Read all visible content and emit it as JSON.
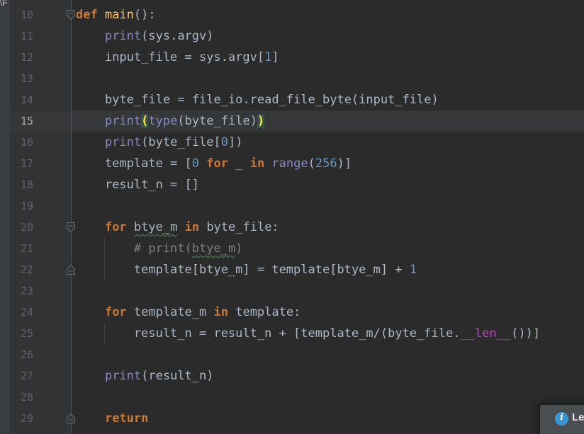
{
  "theme": {
    "bg-editor": "#2B2B2B",
    "bg-gutter": "#313335",
    "bg-active-line": "#353739",
    "keyword-color": "#CC7832",
    "builtin-color": "#8888C6",
    "function-color": "#FFC66D",
    "number-color": "#6897BB",
    "comment-color": "#808080",
    "dunder-color": "#B44EB4",
    "matched-paren-color": "#FFEF28",
    "matched-paren-bg": "#3B514D",
    "typo-squiggle-color": "#4F8F51",
    "notification-accent": "#3896D3"
  },
  "side_strip": {
    "label": "\\F"
  },
  "editor": {
    "active_line": "15",
    "lines": [
      {
        "num": "10",
        "fold": "start",
        "tokens": [
          [
            "k",
            "def"
          ],
          [
            "d",
            " "
          ],
          [
            "f",
            "main"
          ],
          [
            "d",
            "():"
          ]
        ]
      },
      {
        "num": "11",
        "tokens": [
          [
            "d",
            "    "
          ],
          [
            "b",
            "print"
          ],
          [
            "d",
            "(sys.argv)"
          ]
        ]
      },
      {
        "num": "12",
        "tokens": [
          [
            "d",
            "    input_file = sys.argv["
          ],
          [
            "n",
            "1"
          ],
          [
            "d",
            "]"
          ]
        ]
      },
      {
        "num": "13",
        "tokens": []
      },
      {
        "num": "14",
        "tokens": [
          [
            "d",
            "    byte_file = file_io.read_file_byte(input_file)"
          ]
        ]
      },
      {
        "num": "15",
        "tokens": [
          [
            "d",
            "    "
          ],
          [
            "b",
            "print"
          ],
          [
            "pm",
            "("
          ],
          [
            "b",
            "type"
          ],
          [
            "d",
            "(byte_file)"
          ],
          [
            "pm",
            ")"
          ]
        ]
      },
      {
        "num": "16",
        "tokens": [
          [
            "d",
            "    "
          ],
          [
            "b",
            "print"
          ],
          [
            "d",
            "(byte_file["
          ],
          [
            "n",
            "0"
          ],
          [
            "d",
            "])"
          ]
        ]
      },
      {
        "num": "17",
        "tokens": [
          [
            "d",
            "    template = ["
          ],
          [
            "n",
            "0"
          ],
          [
            "d",
            " "
          ],
          [
            "k",
            "for"
          ],
          [
            "d",
            " _ "
          ],
          [
            "k",
            "in"
          ],
          [
            "d",
            " "
          ],
          [
            "b",
            "range"
          ],
          [
            "d",
            "("
          ],
          [
            "n",
            "256"
          ],
          [
            "d",
            ")]"
          ]
        ]
      },
      {
        "num": "18",
        "tokens": [
          [
            "d",
            "    result_n = []"
          ]
        ]
      },
      {
        "num": "19",
        "tokens": []
      },
      {
        "num": "20",
        "fold": "start",
        "tokens": [
          [
            "d",
            "    "
          ],
          [
            "k",
            "for"
          ],
          [
            "d",
            " "
          ],
          [
            "t",
            "btye_m"
          ],
          [
            "d",
            " "
          ],
          [
            "k",
            "in"
          ],
          [
            "d",
            " byte_file:"
          ]
        ]
      },
      {
        "num": "21",
        "tokens": [
          [
            "c",
            "        # print("
          ],
          [
            "ct",
            "btye_m"
          ],
          [
            "c",
            ")"
          ]
        ]
      },
      {
        "num": "22",
        "fold": "end",
        "tokens": [
          [
            "d",
            "        template[btye_m] = template[btye_m] + "
          ],
          [
            "n",
            "1"
          ]
        ]
      },
      {
        "num": "23",
        "tokens": []
      },
      {
        "num": "24",
        "tokens": [
          [
            "d",
            "    "
          ],
          [
            "k",
            "for"
          ],
          [
            "d",
            " template_m "
          ],
          [
            "k",
            "in"
          ],
          [
            "d",
            " template:"
          ]
        ]
      },
      {
        "num": "25",
        "tokens": [
          [
            "d",
            "        result_n = result_n + [template_m/(byte_file."
          ],
          [
            "m",
            "__len__"
          ],
          [
            "d",
            "())]"
          ]
        ]
      },
      {
        "num": "26",
        "tokens": []
      },
      {
        "num": "27",
        "tokens": [
          [
            "d",
            "    "
          ],
          [
            "b",
            "print"
          ],
          [
            "d",
            "(result_n)"
          ]
        ]
      },
      {
        "num": "28",
        "tokens": []
      },
      {
        "num": "29",
        "fold": "end",
        "tokens": [
          [
            "d",
            "    "
          ],
          [
            "k",
            "return"
          ]
        ]
      }
    ]
  },
  "notification": {
    "icon_glyph": "i",
    "label": "Le"
  }
}
